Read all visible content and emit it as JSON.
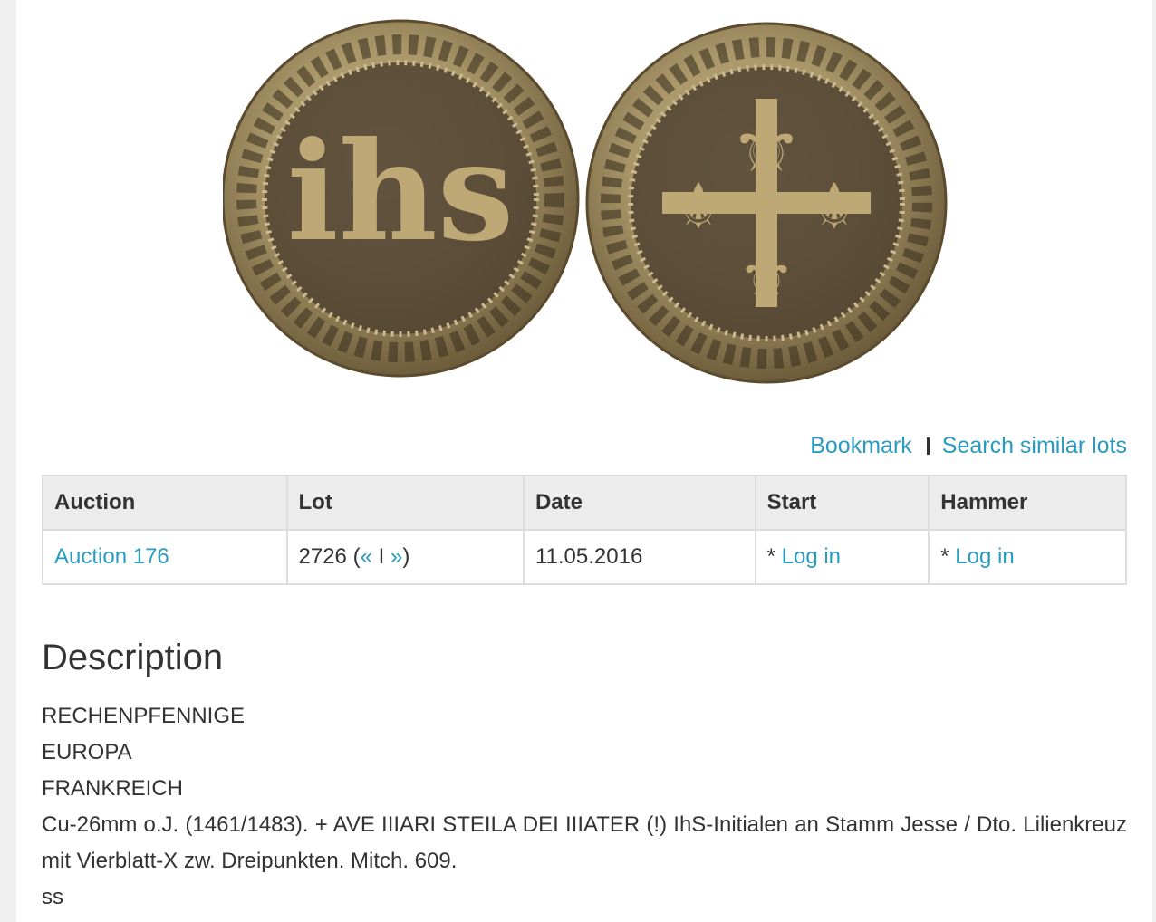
{
  "actions": {
    "bookmark": "Bookmark",
    "search_similar": "Search similar lots"
  },
  "table": {
    "headers": [
      "Auction",
      "Lot",
      "Date",
      "Start",
      "Hammer"
    ],
    "row": {
      "auction": "Auction 176",
      "lot_number": "2726",
      "lot_prev": "«",
      "lot_sep": "I",
      "lot_next": "»",
      "date": "11.05.2016",
      "start_prefix": "* ",
      "start_link": "Log in",
      "hammer_prefix": "* ",
      "hammer_link": "Log in"
    }
  },
  "description": {
    "title": "Description",
    "category1": "RECHENPFENNIGE",
    "category2": "EUROPA",
    "category3": "FRANKREICH",
    "text": "Cu-26mm o.J. (1461/1483). + AVE IIIARI STEILA DEI IIIATER (!) IhS-Initialen an Stamm Jesse / Dto. Lilienkreuz mit Vierblatt-X zw. Dreipunkten. Mitch. 609.",
    "grade": "ss"
  },
  "colors": {
    "link": "#2a9bc0",
    "text": "#333333",
    "header_bg": "#ececec",
    "coin": "#a89568"
  }
}
